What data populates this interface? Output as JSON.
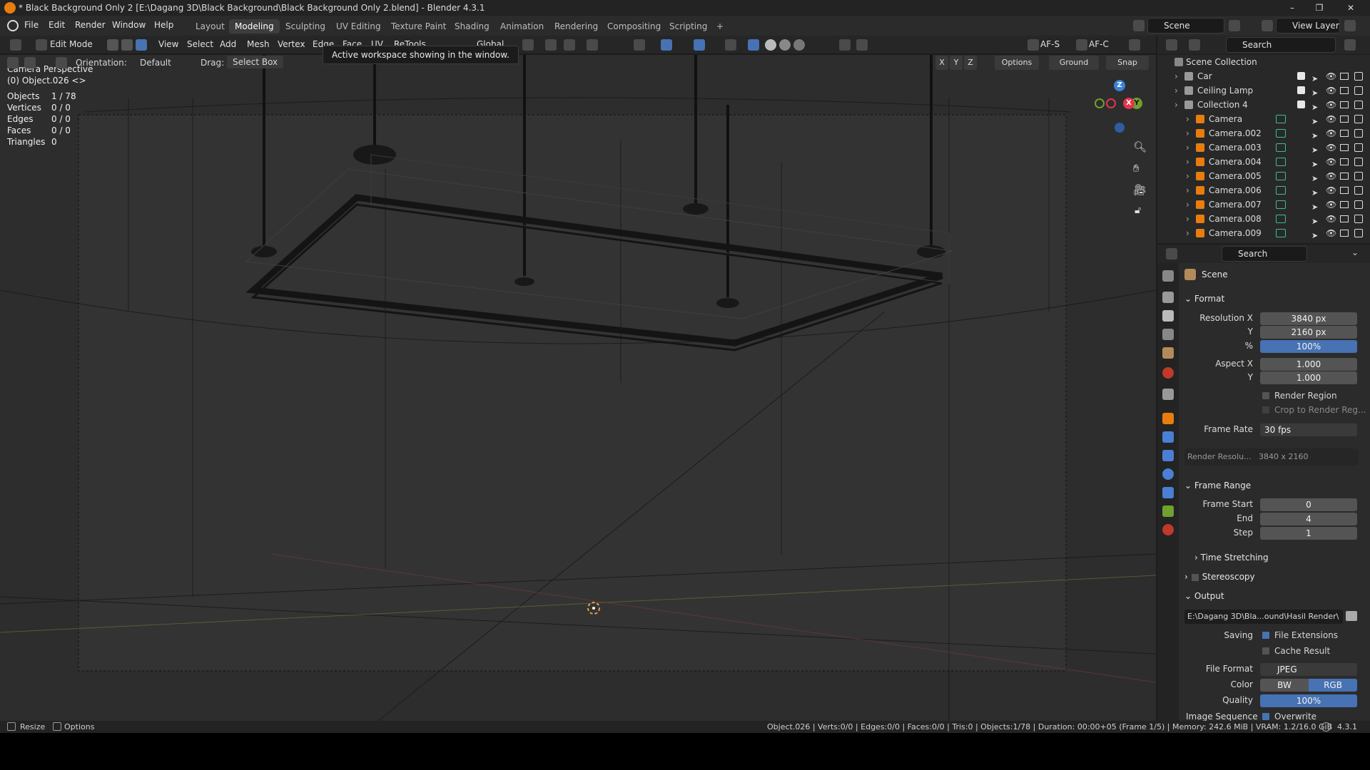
{
  "window": {
    "title": "* Black Background Only 2 [E:\\Dagang 3D\\Black Background\\Black Background Only 2.blend] - Blender 4.3.1",
    "min": "–",
    "max": "❐",
    "close": "✕"
  },
  "menu": {
    "items": [
      "File",
      "Edit",
      "Render",
      "Window",
      "Help"
    ]
  },
  "workspaces": {
    "tabs": [
      "Layout",
      "Modeling",
      "Sculpting",
      "UV Editing",
      "Texture Paint",
      "Shading",
      "Animation",
      "Rendering",
      "Compositing",
      "Scripting"
    ],
    "active": "Modeling",
    "add": "+"
  },
  "topright": {
    "scene": "Scene",
    "view_layer": "View Layer"
  },
  "tooltip": "Active workspace showing in the window.",
  "header": {
    "mode": "Edit Mode",
    "menus": [
      "View",
      "Select",
      "Add",
      "Mesh",
      "Vertex",
      "Edge",
      "Face",
      "UV",
      "ReTools"
    ],
    "transform": "Global",
    "afs": "AF-S",
    "afc": "AF-C"
  },
  "tool_header": {
    "orientation_label": "Orientation:",
    "orientation": "Default",
    "drag_label": "Drag:",
    "drag": "Select Box",
    "axes": [
      "X",
      "Y",
      "Z"
    ],
    "options": "Options",
    "ground": "Ground",
    "snap": "Snap"
  },
  "viewport": {
    "view_name": "Camera Perspective",
    "object_label": "(0) Object.026 <>",
    "stats": [
      {
        "k": "Objects",
        "v": "1 / 78"
      },
      {
        "k": "Vertices",
        "v": "0 / 0"
      },
      {
        "k": "Edges",
        "v": "0 / 0"
      },
      {
        "k": "Faces",
        "v": "0 / 0"
      },
      {
        "k": "Triangles",
        "v": "0"
      }
    ],
    "gizmo": {
      "x": "X",
      "y": "Y",
      "z": "Z"
    }
  },
  "outliner": {
    "search_placeholder": "Search",
    "root": "Scene Collection",
    "items": [
      {
        "name": "Car",
        "indent": 0
      },
      {
        "name": "Ceiling Lamp",
        "indent": 0
      },
      {
        "name": "Collection 4",
        "indent": 0
      },
      {
        "name": "Camera",
        "indent": 1
      },
      {
        "name": "Camera.002",
        "indent": 1
      },
      {
        "name": "Camera.003",
        "indent": 1
      },
      {
        "name": "Camera.004",
        "indent": 1
      },
      {
        "name": "Camera.005",
        "indent": 1
      },
      {
        "name": "Camera.006",
        "indent": 1
      },
      {
        "name": "Camera.007",
        "indent": 1
      },
      {
        "name": "Camera.008",
        "indent": 1
      },
      {
        "name": "Camera.009",
        "indent": 1
      }
    ]
  },
  "properties": {
    "search_placeholder": "Search",
    "context": "Scene",
    "format": {
      "title": "Format",
      "res_x_label": "Resolution X",
      "res_x": "3840 px",
      "res_y_label": "Y",
      "res_y": "2160 px",
      "pct_label": "%",
      "pct": "100%",
      "aspect_x_label": "Aspect X",
      "aspect_x": "1.000",
      "aspect_y_label": "Y",
      "aspect_y": "1.000",
      "render_region": "Render Region",
      "crop": "Crop to Render Reg...",
      "frame_rate_label": "Frame Rate",
      "frame_rate": "30 fps",
      "render_res_label": "Render Resolu...",
      "render_res": "3840 x 2160"
    },
    "frame_range": {
      "title": "Frame Range",
      "start_label": "Frame Start",
      "start": "0",
      "end_label": "End",
      "end": "4",
      "step_label": "Step",
      "step": "1",
      "time_stretching": "Time Stretching",
      "stereoscopy": "Stereoscopy"
    },
    "output": {
      "title": "Output",
      "path": "E:\\Dagang 3D\\Bla...ound\\Hasil Render\\",
      "saving_label": "Saving",
      "file_ext": "File Extensions",
      "cache": "Cache Result",
      "format_label": "File Format",
      "format": "JPEG",
      "color_label": "Color",
      "bw": "BW",
      "rgb": "RGB",
      "quality_label": "Quality",
      "quality": "100%",
      "image_seq_label": "Image Sequence",
      "overwrite": "Overwrite"
    }
  },
  "statusbar": {
    "resize": "Resize",
    "options": "Options",
    "info": "Object.026 | Verts:0/0 | Edges:0/0 | Faces:0/0 | Tris:0 | Objects:1/78 | Duration: 00:00+05 (Frame 1/5) | Memory: 242.6 MiB | VRAM: 1.2/16.0 GiB",
    "version": "4.3.1"
  },
  "colors": {
    "accent": "#4772b3",
    "x_axis": "#e6334d",
    "y_axis": "#6fa030",
    "z_axis": "#3b82d6"
  }
}
